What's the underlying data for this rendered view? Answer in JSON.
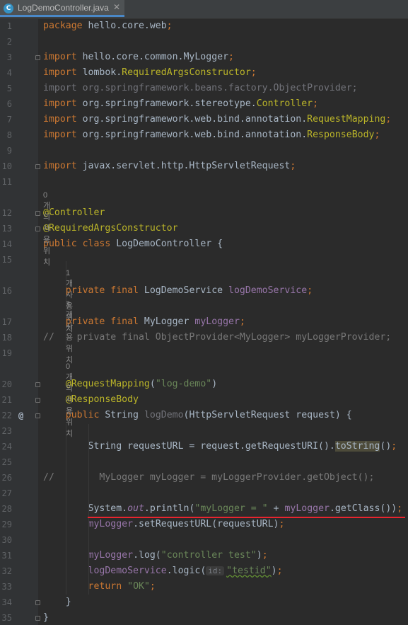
{
  "tab": {
    "icon_text": "C",
    "label": "LogDemoController.java",
    "close": "✕"
  },
  "gutter_marker": "@",
  "lines": [
    {
      "n": "1",
      "parts": [
        [
          "package",
          "kw"
        ],
        [
          " hello.core.web",
          ""
        ],
        [
          ";",
          "kw"
        ]
      ]
    },
    {
      "n": "2",
      "parts": []
    },
    {
      "n": "3",
      "parts": [
        [
          "import",
          "kw"
        ],
        [
          " hello.core.common.MyLogger",
          ""
        ],
        [
          ";",
          "kw"
        ]
      ]
    },
    {
      "n": "4",
      "parts": [
        [
          "import",
          "kw"
        ],
        [
          " lombok.",
          ""
        ],
        [
          "RequiredArgsConstructor",
          "ann"
        ],
        [
          ";",
          "kw"
        ]
      ]
    },
    {
      "n": "5",
      "parts": [
        [
          "import org.springframework.beans.factory.ObjectProvider;",
          "unused"
        ]
      ]
    },
    {
      "n": "6",
      "parts": [
        [
          "import",
          "kw"
        ],
        [
          " org.springframework.stereotype.",
          ""
        ],
        [
          "Controller",
          "ann"
        ],
        [
          ";",
          "kw"
        ]
      ]
    },
    {
      "n": "7",
      "parts": [
        [
          "import",
          "kw"
        ],
        [
          " org.springframework.web.bind.annotation.",
          ""
        ],
        [
          "RequestMapping",
          "ann"
        ],
        [
          ";",
          "kw"
        ]
      ]
    },
    {
      "n": "8",
      "parts": [
        [
          "import",
          "kw"
        ],
        [
          " org.springframework.web.bind.annotation.",
          ""
        ],
        [
          "ResponseBody",
          "ann"
        ],
        [
          ";",
          "kw"
        ]
      ]
    },
    {
      "n": "9",
      "parts": []
    },
    {
      "n": "10",
      "parts": [
        [
          "import",
          "kw"
        ],
        [
          " javax.servlet.http.HttpServletRequest",
          ""
        ],
        [
          ";",
          "kw"
        ]
      ]
    },
    {
      "n": "11",
      "parts": []
    },
    {
      "n": "12",
      "parts": [
        [
          "@Controller",
          "ann"
        ]
      ]
    },
    {
      "n": "13",
      "parts": [
        [
          "@RequiredArgsConstructor",
          "ann"
        ]
      ]
    },
    {
      "n": "14",
      "parts": [
        [
          "public class",
          "kw"
        ],
        [
          " LogDemoController {",
          ""
        ]
      ]
    },
    {
      "n": "15",
      "parts": []
    },
    {
      "n": "16",
      "parts": [
        [
          "    ",
          ""
        ],
        [
          "private final",
          "kw"
        ],
        [
          " LogDemoService ",
          ""
        ],
        [
          "logDemoService",
          "fld"
        ],
        [
          ";",
          "kw"
        ]
      ]
    },
    {
      "n": "17",
      "parts": [
        [
          "    ",
          ""
        ],
        [
          "private final",
          "kw"
        ],
        [
          " MyLogger ",
          ""
        ],
        [
          "myLogger",
          "fld"
        ],
        [
          ";",
          "kw"
        ]
      ]
    },
    {
      "n": "18",
      "parts": [
        [
          "//    private final ObjectProvider<MyLogger> myLoggerProvider;",
          "gray"
        ]
      ]
    },
    {
      "n": "19",
      "parts": []
    },
    {
      "n": "20",
      "parts": [
        [
          "    ",
          ""
        ],
        [
          "@RequestMapping",
          "ann"
        ],
        [
          "(",
          ""
        ],
        [
          "\"log-demo\"",
          "str"
        ],
        [
          ")",
          ""
        ]
      ]
    },
    {
      "n": "21",
      "parts": [
        [
          "    ",
          ""
        ],
        [
          "@ResponseBody",
          "ann"
        ]
      ]
    },
    {
      "n": "22",
      "parts": [
        [
          "    ",
          ""
        ],
        [
          "public",
          "kw"
        ],
        [
          " String ",
          ""
        ],
        [
          "logDemo",
          "unused"
        ],
        [
          "(HttpServletRequest request) {",
          ""
        ]
      ]
    },
    {
      "n": "23",
      "parts": []
    },
    {
      "n": "24",
      "parts": [
        [
          "        String requestURL = request.getRequestURI().",
          ""
        ],
        [
          "toString",
          "hl"
        ],
        [
          "()",
          ""
        ],
        [
          ";",
          "kw"
        ]
      ]
    },
    {
      "n": "25",
      "parts": []
    },
    {
      "n": "26",
      "parts": [
        [
          "//        MyLogger myLogger = myLoggerProvider.getObject();",
          "gray"
        ]
      ]
    },
    {
      "n": "27",
      "parts": []
    },
    {
      "n": "28",
      "parts": [
        [
          "        System.",
          ""
        ],
        [
          "out",
          "stat"
        ],
        [
          ".println(",
          ""
        ],
        [
          "\"myLogger = \"",
          "str"
        ],
        [
          " + ",
          ""
        ],
        [
          "myLogger",
          "fld"
        ],
        [
          ".getClass())",
          ""
        ],
        [
          ";",
          "kw"
        ]
      ]
    },
    {
      "n": "29",
      "parts": [
        [
          "        ",
          ""
        ],
        [
          "myLogger",
          "fld"
        ],
        [
          ".setRequestURL(requestURL)",
          ""
        ],
        [
          ";",
          "kw"
        ]
      ]
    },
    {
      "n": "30",
      "parts": []
    },
    {
      "n": "31",
      "parts": [
        [
          "        ",
          ""
        ],
        [
          "myLogger",
          "fld"
        ],
        [
          ".log(",
          ""
        ],
        [
          "\"controller test\"",
          "str"
        ],
        [
          ")",
          ""
        ],
        [
          ";",
          "kw"
        ]
      ]
    },
    {
      "n": "32",
      "parts": [
        [
          "        ",
          ""
        ],
        [
          "logDemoService",
          "fld"
        ],
        [
          ".logic(",
          ""
        ],
        [
          "id:",
          "inlay"
        ],
        [
          "\"testid\"",
          "strw"
        ],
        [
          ")",
          ""
        ],
        [
          ";",
          "kw"
        ]
      ]
    },
    {
      "n": "33",
      "parts": [
        [
          "        ",
          ""
        ],
        [
          "return",
          "kw"
        ],
        [
          " ",
          ""
        ],
        [
          "\"OK\"",
          "str"
        ],
        [
          ";",
          "kw"
        ]
      ]
    },
    {
      "n": "34",
      "parts": [
        [
          "    }",
          ""
        ]
      ]
    },
    {
      "n": "35",
      "parts": [
        [
          "}",
          ""
        ]
      ]
    }
  ],
  "hints": [
    {
      "text": "0개의 사용위치",
      "before": "12",
      "indent": 0
    },
    {
      "text": "1개 사용 위치",
      "before": "16",
      "indent": 1
    },
    {
      "text": "3개 사용 위치",
      "before": "17",
      "indent": 1
    },
    {
      "text": "0개의 사용위치",
      "before": "20",
      "indent": 1
    }
  ]
}
